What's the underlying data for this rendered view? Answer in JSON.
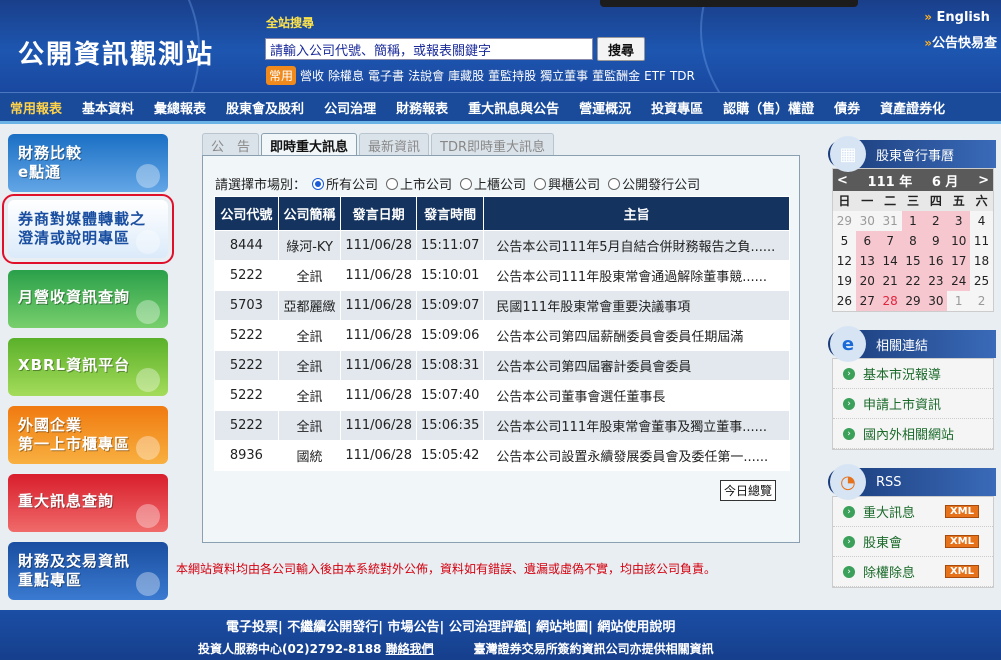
{
  "header": {
    "site_title": "公開資訊觀測站",
    "search_heading": "全站搜尋",
    "search_placeholder": "請輸入公司代號、簡稱，或報表關鍵字",
    "search_button": "搜尋",
    "quick_badge": "常用",
    "quick_links": [
      "營收",
      "除權息",
      "電子書",
      "法說會",
      "庫藏股",
      "董監持股",
      "獨立董事",
      "董監酬金",
      "ETF",
      "TDR"
    ],
    "lang_english": "English",
    "announcement_search": "公告快易查"
  },
  "nav": [
    "常用報表",
    "基本資料",
    "彙總報表",
    "股東會及股利",
    "公司治理",
    "財務報表",
    "重大訊息與公告",
    "營運概況",
    "投資專區",
    "認購（售）權證",
    "債券",
    "資產證券化"
  ],
  "left_promos": [
    {
      "line1": "財務比較",
      "line2": "e點通",
      "colors": [
        "#1a6fc4",
        "#63a6e6"
      ]
    },
    {
      "line1": "券商對媒體轉載之",
      "line2": "澄清或說明專區",
      "colors": [
        "#1f6cc8",
        "#4c96e0"
      ]
    },
    {
      "line1": "月營收資訊查詢",
      "line2": "",
      "colors": [
        "#2aa04a",
        "#78cf6c"
      ]
    },
    {
      "line1": "XBRL資訊平台",
      "line2": "",
      "colors": [
        "#5ab02a",
        "#a4dc5a"
      ]
    },
    {
      "line1": "外國企業",
      "line2": "第一上市櫃專區",
      "colors": [
        "#f07a10",
        "#f8b040"
      ]
    },
    {
      "line1": "重大訊息查詢",
      "line2": "",
      "colors": [
        "#d81e2c",
        "#f06a6a"
      ]
    },
    {
      "line1": "財務及交易資訊",
      "line2": "重點專區",
      "colors": [
        "#1a4ea0",
        "#3a7ad0"
      ]
    }
  ],
  "tabs": [
    "公　告",
    "即時重大訊息",
    "最新資訊",
    "TDR即時重大訊息"
  ],
  "market": {
    "label": "請選擇市場別：",
    "options": [
      "所有公司",
      "上市公司",
      "上櫃公司",
      "興櫃公司",
      "公開發行公司"
    ],
    "selected": 0
  },
  "table": {
    "headers": [
      "公司代號",
      "公司簡稱",
      "發言日期",
      "發言時間",
      "主旨"
    ],
    "rows": [
      [
        "8444",
        "綠河-KY",
        "111/06/28",
        "15:11:07",
        "公告本公司111年5月自結合併財務報告之負......"
      ],
      [
        "5222",
        "全訊",
        "111/06/28",
        "15:10:01",
        "公告本公司111年股東常會通過解除董事競......"
      ],
      [
        "5703",
        "亞都麗緻",
        "111/06/28",
        "15:09:07",
        "民國111年股東常會重要決議事項"
      ],
      [
        "5222",
        "全訊",
        "111/06/28",
        "15:09:06",
        "公告本公司第四屆薪酬委員會委員任期屆滿"
      ],
      [
        "5222",
        "全訊",
        "111/06/28",
        "15:08:31",
        "公告本公司第四屆審計委員會委員"
      ],
      [
        "5222",
        "全訊",
        "111/06/28",
        "15:07:40",
        "公告本公司董事會選任董事長"
      ],
      [
        "5222",
        "全訊",
        "111/06/28",
        "15:06:35",
        "公告本公司111年股東常會董事及獨立董事......"
      ],
      [
        "8936",
        "國統",
        "111/06/28",
        "15:05:42",
        "公告本公司設置永續發展委員會及委任第一......"
      ]
    ],
    "today_button": "今日總覽"
  },
  "disclaimer": "本網站資料均由各公司輸入後由本系統對外公佈，資料如有錯誤、遺漏或虛偽不實，均由該公司負責。",
  "calendar": {
    "title": "股東會行事曆",
    "year_label": "111 年",
    "month_label": "6 月",
    "prev": "<",
    "next": ">",
    "weekdays": [
      "日",
      "一",
      "二",
      "三",
      "四",
      "五",
      "六"
    ],
    "days": [
      {
        "d": "29",
        "t": "other"
      },
      {
        "d": "30",
        "t": "other"
      },
      {
        "d": "31",
        "t": "other"
      },
      {
        "d": "1",
        "t": "hl"
      },
      {
        "d": "2",
        "t": "hl"
      },
      {
        "d": "3",
        "t": "hl"
      },
      {
        "d": "4",
        "t": ""
      },
      {
        "d": "5",
        "t": ""
      },
      {
        "d": "6",
        "t": "hl"
      },
      {
        "d": "7",
        "t": "hl"
      },
      {
        "d": "8",
        "t": "hl"
      },
      {
        "d": "9",
        "t": "hl"
      },
      {
        "d": "10",
        "t": "hl"
      },
      {
        "d": "11",
        "t": ""
      },
      {
        "d": "12",
        "t": ""
      },
      {
        "d": "13",
        "t": "hl"
      },
      {
        "d": "14",
        "t": "hl"
      },
      {
        "d": "15",
        "t": "hl"
      },
      {
        "d": "16",
        "t": "hl"
      },
      {
        "d": "17",
        "t": "hl"
      },
      {
        "d": "18",
        "t": ""
      },
      {
        "d": "19",
        "t": ""
      },
      {
        "d": "20",
        "t": "hl"
      },
      {
        "d": "21",
        "t": "hl"
      },
      {
        "d": "22",
        "t": "hl"
      },
      {
        "d": "23",
        "t": "hl"
      },
      {
        "d": "24",
        "t": "hl"
      },
      {
        "d": "25",
        "t": ""
      },
      {
        "d": "26",
        "t": ""
      },
      {
        "d": "27",
        "t": "hl"
      },
      {
        "d": "28",
        "t": "today"
      },
      {
        "d": "29",
        "t": "hl"
      },
      {
        "d": "30",
        "t": "hl"
      },
      {
        "d": "1",
        "t": "other"
      },
      {
        "d": "2",
        "t": "other"
      }
    ]
  },
  "related": {
    "title": "相關連結",
    "links": [
      "基本市況報導",
      "申請上市資訊",
      "國內外相關網站"
    ]
  },
  "rss": {
    "title": "RSS",
    "links": [
      "重大訊息",
      "股東會",
      "除權除息"
    ],
    "badge": "XML"
  },
  "footer": {
    "links": "電子投票| 不繼續公開發行| 市場公告| 公司治理評鑑| 網站地圖| 網站使用說明",
    "service": "投資人服務中心(02)2792-8188",
    "contact": "聯絡我們",
    "provider": "臺灣證券交易所簽約資訊公司亦提供相關資訊"
  },
  "colors": {
    "header_blue": "#1d56b0",
    "table_header": "#14335f",
    "disclaimer_red": "#d4000f",
    "calendar_highlight": "#f7c7d0"
  }
}
